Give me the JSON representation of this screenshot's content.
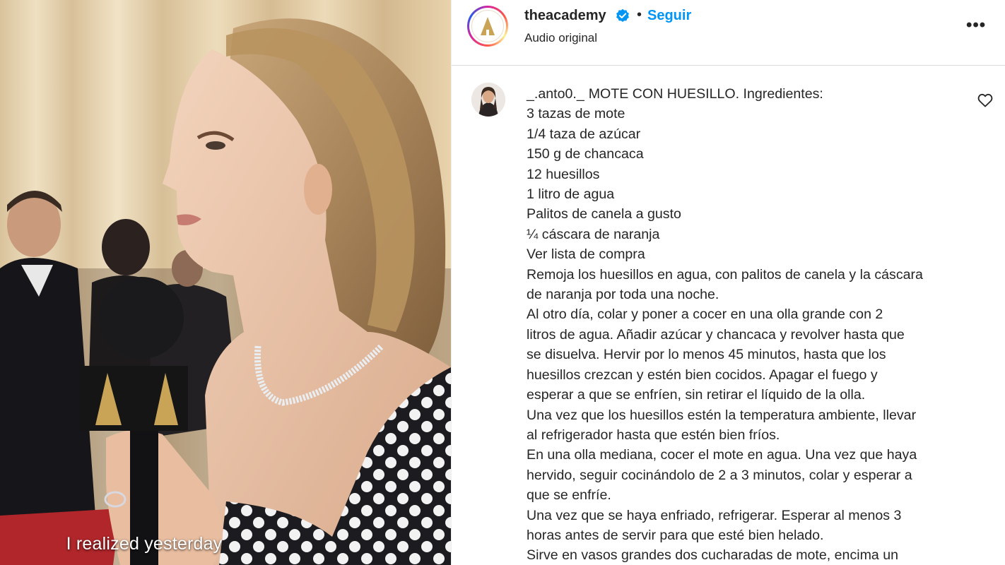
{
  "video": {
    "subtitle_text": "I realized yesterday",
    "scene": "red-carpet-interview"
  },
  "header": {
    "username": "theacademy",
    "verified_icon": "verified-badge-icon",
    "separator": "•",
    "follow_label": "Seguir",
    "audio_label": "Audio original",
    "more_icon": "more-options-icon",
    "more_label": "•••"
  },
  "comment": {
    "author": "_.anto0._",
    "lines": [
      "MOTE CON HUESILLO. Ingredientes:",
      "3 tazas de mote",
      "1/4 taza de azúcar",
      "150 g de chancaca",
      "12 huesillos",
      "1 litro de agua",
      "Palitos de canela a gusto",
      "¼ cáscara de naranja",
      "Ver lista de compra",
      "Remoja los huesillos en agua, con palitos de canela y la cáscara",
      "de naranja por toda una noche.",
      "Al otro día, colar y poner a cocer en una olla grande con 2",
      "litros de agua. Añadir azúcar y chancaca y revolver hasta que",
      "se disuelva. Hervir por lo menos 45 minutos, hasta que los",
      "huesillos crezcan y estén bien cocidos. Apagar el fuego y",
      "esperar a que se enfríen, sin retirar el líquido de la olla.",
      "Una vez que los huesillos estén la temperatura ambiente, llevar",
      "al refrigerador hasta que estén bien fríos.",
      "En una olla mediana, cocer el mote en agua. Una vez que haya",
      "hervido, seguir cocinándolo de 2 a 3 minutos, colar y esperar a",
      "que se enfríe.",
      "Una vez que se haya enfriado, refrigerar. Esperar al menos 3",
      "horas antes de servir para que esté bien helado.",
      "Sirve en vasos grandes dos cucharadas de mote, encima un"
    ],
    "like_icon": "heart-icon"
  },
  "colors": {
    "link_blue": "#0095f6",
    "text": "#262626",
    "divider": "#dbdbdb",
    "verified_blue": "#0095f6"
  }
}
